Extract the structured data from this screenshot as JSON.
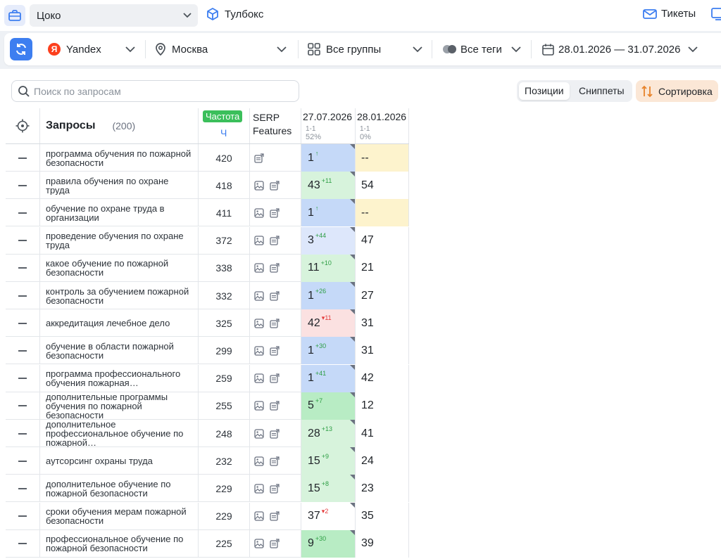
{
  "topbar": {
    "project": "Цоко",
    "toolbox": "Тулбокс",
    "tickets": "Тикеты"
  },
  "filters": {
    "engine": "Yandex",
    "engine_logo": "Я",
    "region": "Москва",
    "groups": "Все группы",
    "tags": "Все теги",
    "date_range": "28.01.2026 — 31.07.2026"
  },
  "toolbar": {
    "search_placeholder": "Поиск по запросам",
    "tab_positions": "Позиции",
    "tab_snippets": "Сниппеты",
    "sort_label": "Сортировка"
  },
  "table": {
    "title": "Запросы",
    "count": "(200)",
    "freq_badge": "Частота",
    "freq_sub": "Ч",
    "serp_title_1": "SERP",
    "serp_title_2": "Features",
    "col1_date": "27.07.2026",
    "col1_range": "1-1",
    "col1_pct": "52%",
    "col2_date": "28.01.2026",
    "col2_range": "1-1",
    "col2_pct": "0%",
    "rows": [
      {
        "query": "программа обучения по пожарной безопасности",
        "freq": "420",
        "serp": [
          "sitelinks"
        ],
        "p1": "1",
        "c1": "↑",
        "c1dir": "up",
        "bg1": "#c5d9f8",
        "p2": "--",
        "bg2": "#fdf3cd"
      },
      {
        "query": "правила обучения по охране труда",
        "freq": "418",
        "serp": [
          "image",
          "sitelinks"
        ],
        "p1": "43",
        "c1": "+11",
        "c1dir": "up",
        "bg1": "#d7f3dc",
        "p2": "54",
        "bg2": "#ffffff"
      },
      {
        "query": "обучение по охране труда в организации",
        "freq": "411",
        "serp": [
          "image",
          "sitelinks"
        ],
        "p1": "1",
        "c1": "↑",
        "c1dir": "up",
        "bg1": "#c5d9f8",
        "p2": "--",
        "bg2": "#fdf3cd"
      },
      {
        "query": "проведение обучения по охране труда",
        "freq": "372",
        "serp": [
          "image",
          "sitelinks"
        ],
        "p1": "3",
        "c1": "+44",
        "c1dir": "up",
        "bg1": "#dde7fb",
        "p2": "47",
        "bg2": "#ffffff"
      },
      {
        "query": "какое обучение по пожарной безопасности",
        "freq": "338",
        "serp": [
          "image",
          "sitelinks"
        ],
        "p1": "11",
        "c1": "+10",
        "c1dir": "up",
        "bg1": "#d7f3dc",
        "p2": "21",
        "bg2": "#ffffff"
      },
      {
        "query": "контроль за обучением пожарной безопасности",
        "freq": "332",
        "serp": [
          "image",
          "sitelinks"
        ],
        "p1": "1",
        "c1": "+26",
        "c1dir": "up",
        "bg1": "#c5d9f8",
        "p2": "27",
        "bg2": "#ffffff"
      },
      {
        "query": "аккредитация лечебное дело",
        "freq": "325",
        "serp": [
          "image",
          "sitelinks"
        ],
        "p1": "42",
        "c1": "▾11",
        "c1dir": "down",
        "bg1": "#fbe1e1",
        "p2": "31",
        "bg2": "#ffffff"
      },
      {
        "query": "обучение в области пожарной безопасности",
        "freq": "299",
        "serp": [
          "image",
          "sitelinks"
        ],
        "p1": "1",
        "c1": "+30",
        "c1dir": "up",
        "bg1": "#c5d9f8",
        "p2": "31",
        "bg2": "#ffffff"
      },
      {
        "query": "программа профессионального обучения пожарная…",
        "freq": "259",
        "serp": [
          "image",
          "sitelinks"
        ],
        "p1": "1",
        "c1": "+41",
        "c1dir": "up",
        "bg1": "#c5d9f8",
        "p2": "42",
        "bg2": "#ffffff"
      },
      {
        "query": "дополнительные программы обучения по пожарной безопасности",
        "freq": "255",
        "serp": [
          "image",
          "sitelinks"
        ],
        "p1": "5",
        "c1": "+7",
        "c1dir": "up",
        "bg1": "#b8ecc4",
        "p2": "12",
        "bg2": "#ffffff"
      },
      {
        "query": "дополнительное профессиональное обучение по пожарной…",
        "freq": "248",
        "serp": [
          "image",
          "sitelinks"
        ],
        "p1": "28",
        "c1": "+13",
        "c1dir": "up",
        "bg1": "#d7f3dc",
        "p2": "41",
        "bg2": "#ffffff"
      },
      {
        "query": "аутсорсинг охраны труда",
        "freq": "232",
        "serp": [
          "image",
          "sitelinks"
        ],
        "p1": "15",
        "c1": "+9",
        "c1dir": "up",
        "bg1": "#d7f3dc",
        "p2": "24",
        "bg2": "#ffffff"
      },
      {
        "query": "дополнительное обучение по пожарной безопасности",
        "freq": "229",
        "serp": [
          "image",
          "sitelinks"
        ],
        "p1": "15",
        "c1": "+8",
        "c1dir": "up",
        "bg1": "#d7f3dc",
        "p2": "23",
        "bg2": "#ffffff"
      },
      {
        "query": "сроки обучения мерам пожарной безопасности",
        "freq": "229",
        "serp": [
          "image",
          "sitelinks"
        ],
        "p1": "37",
        "c1": "▾2",
        "c1dir": "down",
        "bg1": "#ffffff",
        "p2": "35",
        "bg2": "#ffffff"
      },
      {
        "query": "профессиональное обучение по пожарной безопасности",
        "freq": "225",
        "serp": [
          "image",
          "sitelinks"
        ],
        "p1": "9",
        "c1": "+30",
        "c1dir": "up",
        "bg1": "#b8ecc4",
        "p2": "39",
        "bg2": "#ffffff"
      }
    ]
  },
  "colors": {
    "accent": "#3d7ef0",
    "freq_badge": "#3bbf5b",
    "sort_bg": "#fbe7d6",
    "top1": "#c5d9f8",
    "top10": "#b8ecc4",
    "top50": "#d7f3dc",
    "drop": "#fbe1e1",
    "no_data": "#fdf3cd"
  }
}
